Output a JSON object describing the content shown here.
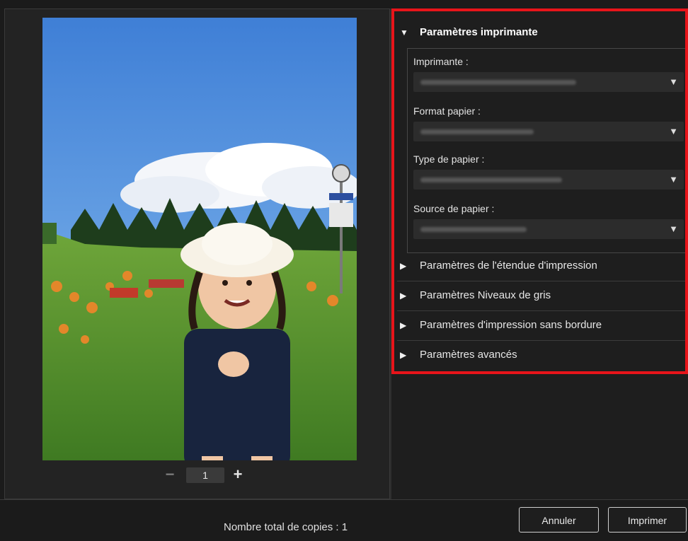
{
  "preview": {
    "copies": "1",
    "minus_label": "−",
    "plus_label": "+"
  },
  "settings": {
    "printer_section": {
      "title": "Paramètres imprimante",
      "fields": [
        {
          "label": "Imprimante :"
        },
        {
          "label": "Format papier :"
        },
        {
          "label": "Type de papier :"
        },
        {
          "label": "Source de papier :"
        }
      ]
    },
    "sections": [
      {
        "title": "Paramètres de l'étendue d'impression"
      },
      {
        "title": "Paramètres Niveaux de gris"
      },
      {
        "title": "Paramètres d'impression sans bordure"
      },
      {
        "title": "Paramètres avancés"
      }
    ]
  },
  "footer": {
    "total_copies": "Nombre total de copies : 1",
    "cancel_label": "Annuler",
    "print_label": "Imprimer"
  },
  "colors": {
    "highlight": "#e8141a",
    "background": "#1b1b1b"
  },
  "icons": {
    "expanded": "triangle-down-icon",
    "collapsed": "triangle-right-icon",
    "dropdown": "dropdown-arrow-icon"
  }
}
